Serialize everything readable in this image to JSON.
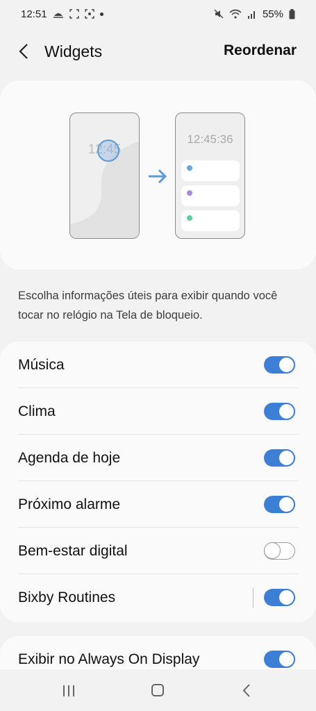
{
  "status_bar": {
    "time": "12:51",
    "battery": "55%"
  },
  "header": {
    "title": "Widgets",
    "action_label": "Reordenar"
  },
  "illustration": {
    "lock_clock_time": "12:45",
    "widget_clock_time": "12:45:36",
    "widget_dot_colors": [
      "#6aa5de",
      "#a48be0",
      "#5ccf98"
    ]
  },
  "description": "Escolha informações úteis para exibir quando você tocar no relógio na Tela de bloqueio.",
  "widgets": [
    {
      "label": "Música",
      "enabled": true
    },
    {
      "label": "Clima",
      "enabled": true
    },
    {
      "label": "Agenda de hoje",
      "enabled": true
    },
    {
      "label": "Próximo alarme",
      "enabled": true
    },
    {
      "label": "Bem-estar digital",
      "enabled": false
    },
    {
      "label": "Bixby Routines",
      "enabled": true
    }
  ],
  "aod": {
    "label": "Exibir no Always On Display",
    "enabled": true
  },
  "colors": {
    "accent": "#3e7fd6",
    "background": "#f2f2f2",
    "card": "#fafafa"
  }
}
